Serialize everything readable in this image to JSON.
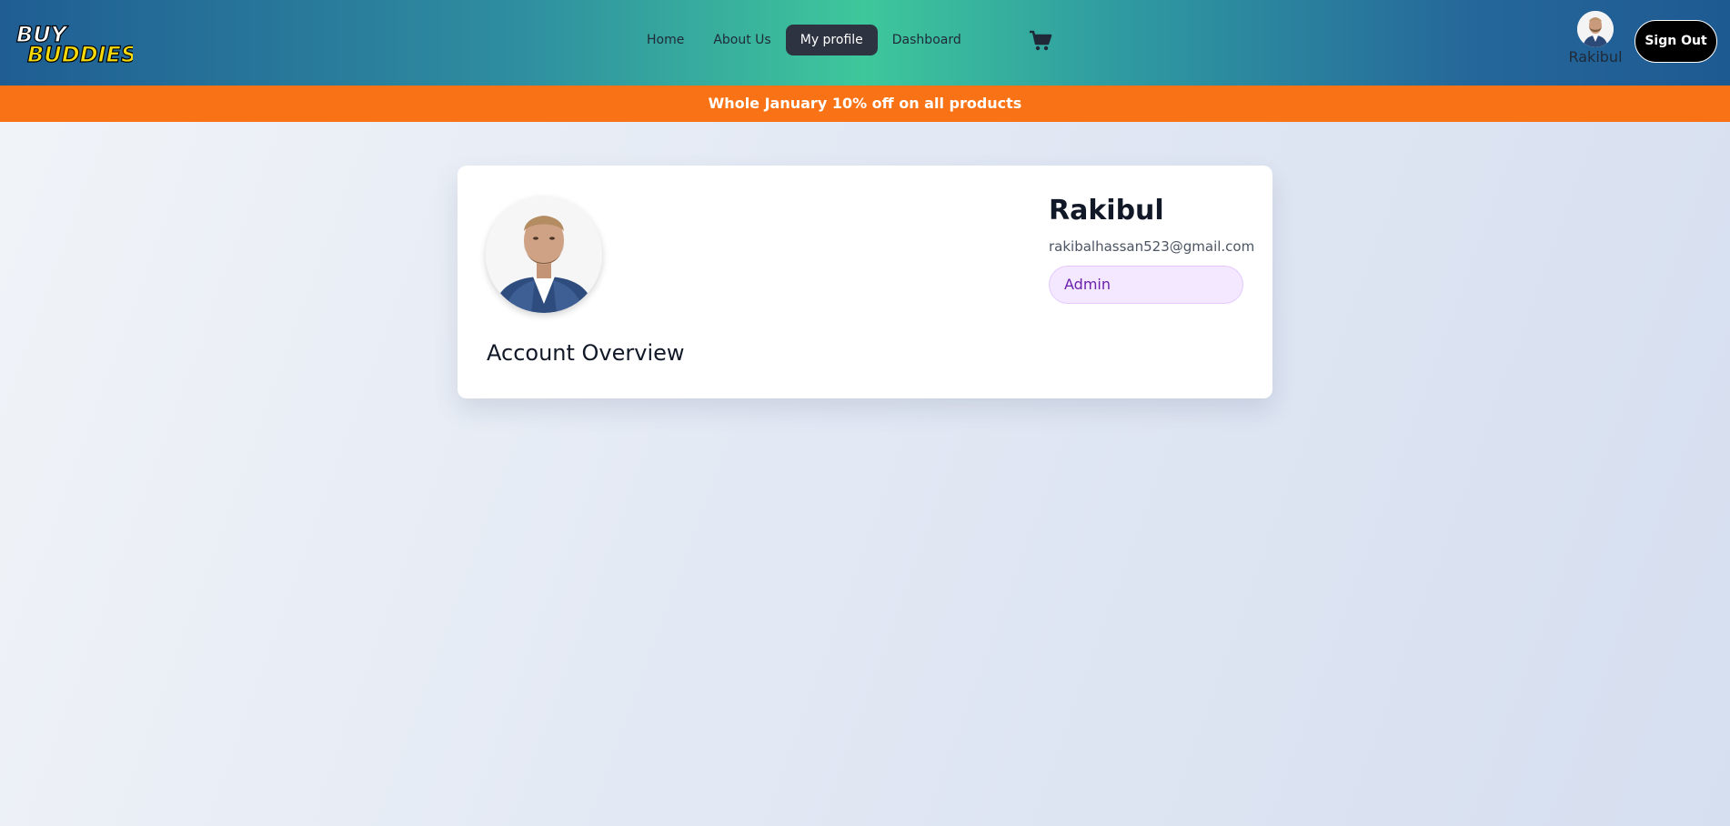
{
  "brand": {
    "logo_line1": "BUY",
    "logo_line2": "BUDDIES"
  },
  "nav": {
    "items": [
      {
        "label": "Home"
      },
      {
        "label": "About Us"
      },
      {
        "label": "My profile"
      },
      {
        "label": "Dashboard"
      }
    ],
    "active": "My profile",
    "cart_icon": "shopping-cart-icon"
  },
  "user": {
    "name": "Rakibul",
    "signout_label": "Sign Out"
  },
  "promo": {
    "text": "Whole January 10% off on all products"
  },
  "profile": {
    "name": "Rakibul",
    "email": "rakibalhassan523@gmail.com",
    "role": "Admin",
    "section_title": "Account Overview"
  },
  "colors": {
    "promo_bg": "#f97316",
    "active_nav_bg": "#2d3340",
    "badge_bg": "#f3e8ff",
    "badge_text": "#6b21a8"
  }
}
